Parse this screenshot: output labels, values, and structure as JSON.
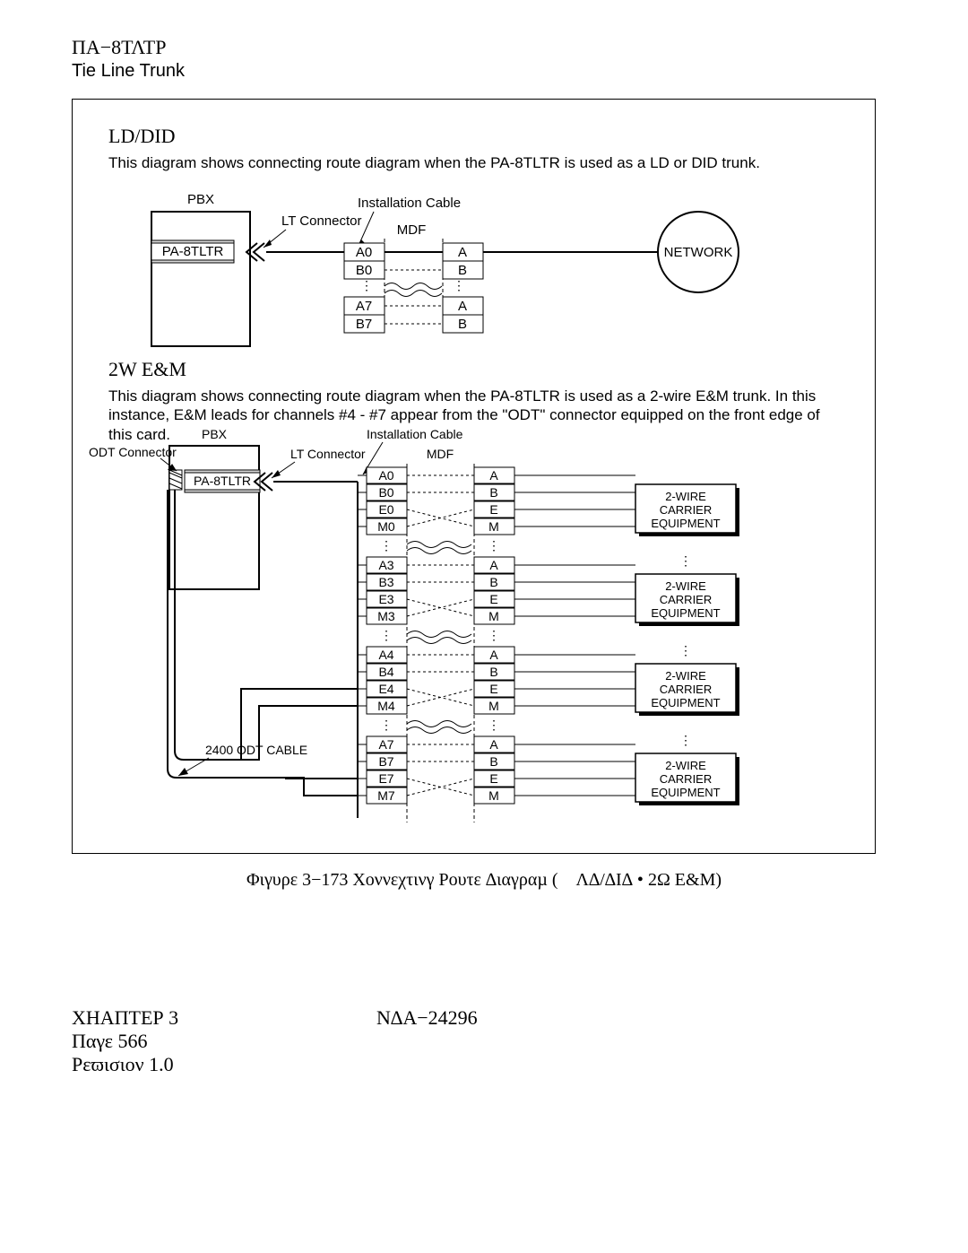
{
  "header": {
    "code": "ΠΑ−8ΤΛΤΡ",
    "title": "Tie Line Trunk"
  },
  "section1": {
    "title": "LD/DID",
    "desc": "This diagram shows connecting route diagram when the PA-8TLTR is used as a LD or DID trunk.",
    "labels": {
      "pbx": "PBX",
      "inst": "Installation Cable",
      "lt": "LT Connector",
      "mdf": "MDF",
      "card": "PA-8TLTR",
      "net": "NETWORK",
      "left": [
        "A0",
        "B0",
        "A7",
        "B7"
      ],
      "right": [
        "A",
        "B",
        "A",
        "B"
      ]
    }
  },
  "section2": {
    "title": "2W E&M",
    "desc": "This diagram shows connecting route diagram when the PA-8TLTR is used as a 2-wire E&M trunk. In this instance, E&M leads for channels #4 - #7 appear from the \"ODT\" connector equipped on the front edge of this card.",
    "labels": {
      "pbx": "PBX",
      "inst": "Installation Cable",
      "lt": "LT Connector",
      "mdf": "MDF",
      "odt": "ODT Connector",
      "card": "PA-8TLTR",
      "cable": "2400 ODT CABLE",
      "equip": "2-WIRE\nCARRIER\nEQUIPMENT",
      "rows": [
        [
          "A0",
          "A"
        ],
        [
          "B0",
          "B"
        ],
        [
          "E0",
          "E"
        ],
        [
          "M0",
          "M"
        ],
        [
          "A3",
          "A"
        ],
        [
          "B3",
          "B"
        ],
        [
          "E3",
          "E"
        ],
        [
          "M3",
          "M"
        ],
        [
          "A4",
          "A"
        ],
        [
          "B4",
          "B"
        ],
        [
          "E4",
          "E"
        ],
        [
          "M4",
          "M"
        ],
        [
          "A7",
          "A"
        ],
        [
          "B7",
          "B"
        ],
        [
          "E7",
          "E"
        ],
        [
          "M7",
          "M"
        ]
      ]
    }
  },
  "caption": "Φιγυρε 3−173   Χοννεχτινγ Ρουτε ∆ιαγραµ ( Λ∆/∆Ι∆  • 2Ω E&M)",
  "footer": {
    "chapter": "ΧΗΑΠΤΕΡ 3",
    "page": "Παγε 566",
    "rev": "Ρεϖισιον 1.0",
    "docnum": "Ν∆Α−24296"
  }
}
